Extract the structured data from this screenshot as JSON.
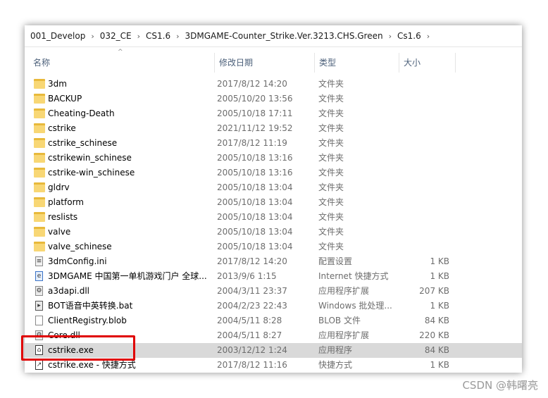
{
  "breadcrumbs": [
    "001_Develop",
    "032_CE",
    "CS1.6",
    "3DMGAME-Counter_Strike.Ver.3213.CHS.Green",
    "Cs1.6"
  ],
  "columns": {
    "name": "名称",
    "date": "修改日期",
    "type": "类型",
    "size": "大小"
  },
  "files": [
    {
      "name": "3dm",
      "date": "2017/8/12 14:20",
      "type": "文件夹",
      "size": "",
      "icon": "folder"
    },
    {
      "name": "BACKUP",
      "date": "2005/10/20 13:56",
      "type": "文件夹",
      "size": "",
      "icon": "folder"
    },
    {
      "name": "Cheating-Death",
      "date": "2005/10/18 17:11",
      "type": "文件夹",
      "size": "",
      "icon": "folder"
    },
    {
      "name": "cstrike",
      "date": "2021/11/12 19:52",
      "type": "文件夹",
      "size": "",
      "icon": "folder"
    },
    {
      "name": "cstrike_schinese",
      "date": "2017/8/12 11:19",
      "type": "文件夹",
      "size": "",
      "icon": "folder"
    },
    {
      "name": "cstrikewin_schinese",
      "date": "2005/10/18 13:16",
      "type": "文件夹",
      "size": "",
      "icon": "folder"
    },
    {
      "name": "cstrike-win_schinese",
      "date": "2005/10/18 13:16",
      "type": "文件夹",
      "size": "",
      "icon": "folder"
    },
    {
      "name": "gldrv",
      "date": "2005/10/18 13:04",
      "type": "文件夹",
      "size": "",
      "icon": "folder"
    },
    {
      "name": "platform",
      "date": "2005/10/18 13:04",
      "type": "文件夹",
      "size": "",
      "icon": "folder"
    },
    {
      "name": "reslists",
      "date": "2005/10/18 13:04",
      "type": "文件夹",
      "size": "",
      "icon": "folder"
    },
    {
      "name": "valve",
      "date": "2005/10/18 13:04",
      "type": "文件夹",
      "size": "",
      "icon": "folder"
    },
    {
      "name": "valve_schinese",
      "date": "2005/10/18 13:04",
      "type": "文件夹",
      "size": "",
      "icon": "folder"
    },
    {
      "name": "3dmConfig.ini",
      "date": "2017/8/12 14:20",
      "type": "配置设置",
      "size": "1 KB",
      "icon": "config-file"
    },
    {
      "name": "3DMGAME 中国第一单机游戏门户 全球...",
      "date": "2013/9/6 1:15",
      "type": "Internet 快捷方式",
      "size": "1 KB",
      "icon": "internet-shortcut"
    },
    {
      "name": "a3dapi.dll",
      "date": "2004/3/11 23:37",
      "type": "应用程序扩展",
      "size": "207 KB",
      "icon": "dll-file"
    },
    {
      "name": "BOT语音中英转换.bat",
      "date": "2004/2/23 22:43",
      "type": "Windows 批处理...",
      "size": "1 KB",
      "icon": "batch-file"
    },
    {
      "name": "ClientRegistry.blob",
      "date": "2004/5/11 8:28",
      "type": "BLOB 文件",
      "size": "84 KB",
      "icon": "blank-file"
    },
    {
      "name": "Core.dll",
      "date": "2004/5/11 8:27",
      "type": "应用程序扩展",
      "size": "220 KB",
      "icon": "dll-file"
    },
    {
      "name": "cstrike.exe",
      "date": "2003/12/12 1:24",
      "type": "应用程序",
      "size": "84 KB",
      "icon": "exe-file",
      "selected": true
    },
    {
      "name": "cstrike.exe - 快捷方式",
      "date": "2017/8/12 11:16",
      "type": "快捷方式",
      "size": "1 KB",
      "icon": "shortcut"
    }
  ],
  "watermark": "CSDN @韩曙亮",
  "colors": {
    "folder": "#f8d775",
    "selected_row": "#d9d9d9",
    "highlight_box": "#e00000",
    "header_text": "#4c607a"
  }
}
